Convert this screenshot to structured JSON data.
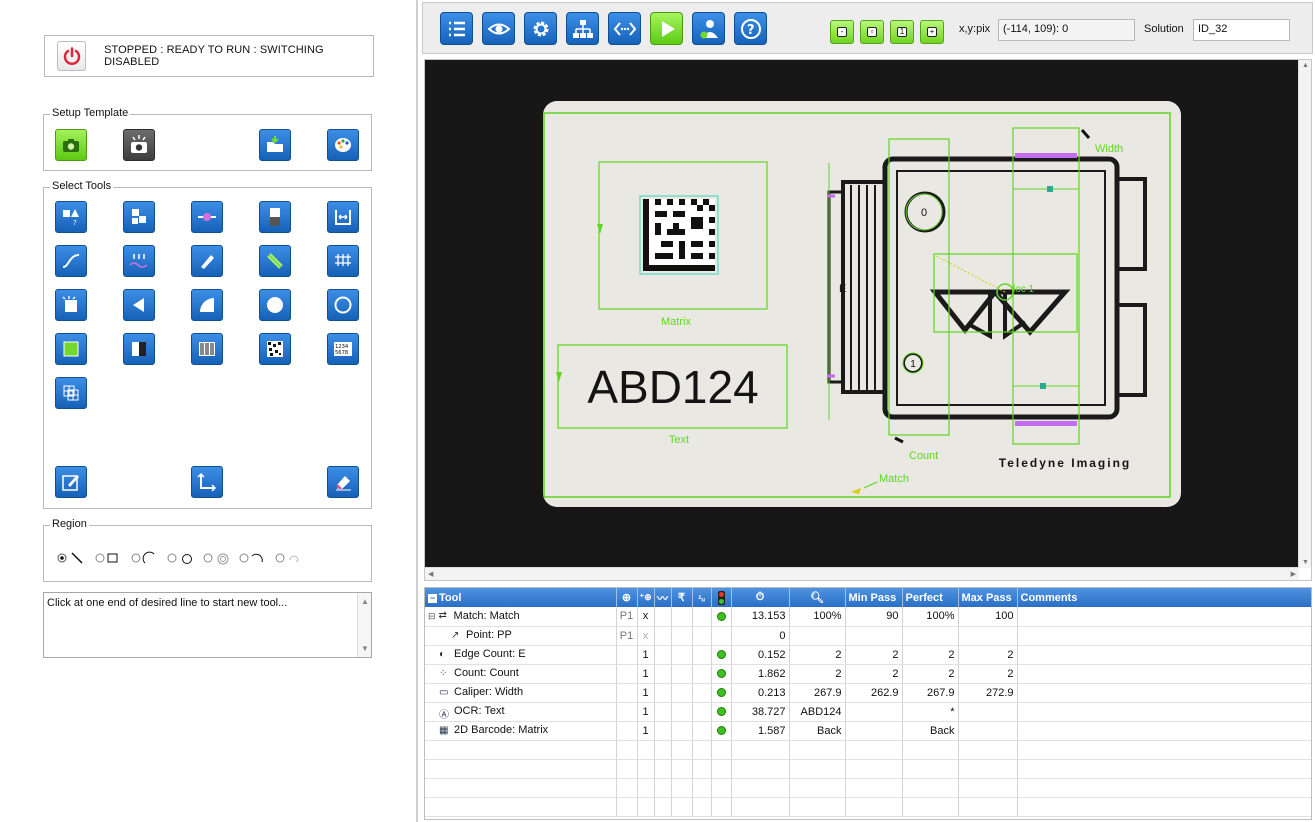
{
  "status": {
    "text": "STOPPED : READY TO RUN : SWITCHING DISABLED"
  },
  "setup_template": {
    "title": "Setup Template"
  },
  "select_tools": {
    "title": "Select Tools"
  },
  "region": {
    "title": "Region"
  },
  "hint": {
    "text": "Click at one end of desired line to start new tool..."
  },
  "toolbar": {
    "xy_label": "x,y:pix",
    "xy_value": "(-114, 109): 0",
    "solution_label": "Solution",
    "solution_value": "ID_32"
  },
  "image": {
    "ocr_text": "ABD124",
    "matrix_label": "Matrix",
    "text_label": "Text",
    "count_label": "Count",
    "match_label": "Match",
    "width_label": "Width",
    "e_label": "E",
    "loc_label": "loc 1",
    "circle0": "0",
    "circle1": "1",
    "brand": "Teledyne Imaging"
  },
  "table": {
    "headers": [
      "Tool",
      "",
      "",
      "",
      "",
      "",
      "",
      "",
      "",
      "Min Pass",
      "Perfect",
      "Max Pass",
      "Comments"
    ],
    "rows": [
      {
        "tool": "Match: Match",
        "ref": "P1",
        "x": "x",
        "time": "13.153",
        "result": "100%",
        "min": "90",
        "perfect": "100%",
        "max": "100",
        "status": true,
        "indent": 0
      },
      {
        "tool": "Point: PP",
        "ref": "P1",
        "x": "x",
        "time": "0",
        "result": "",
        "min": "",
        "perfect": "",
        "max": "",
        "status": false,
        "indent": 1
      },
      {
        "tool": "Edge Count: E",
        "ref": "",
        "x": "1",
        "time": "0.152",
        "result": "2",
        "min": "2",
        "perfect": "2",
        "max": "2",
        "status": true,
        "indent": 0
      },
      {
        "tool": "Count: Count",
        "ref": "",
        "x": "1",
        "time": "1.862",
        "result": "2",
        "min": "2",
        "perfect": "2",
        "max": "2",
        "status": true,
        "indent": 0
      },
      {
        "tool": "Caliper: Width",
        "ref": "",
        "x": "1",
        "time": "0.213",
        "result": "267.9",
        "min": "262.9",
        "perfect": "267.9",
        "max": "272.9",
        "status": true,
        "indent": 0
      },
      {
        "tool": "OCR: Text",
        "ref": "",
        "x": "1",
        "time": "38.727",
        "result": "ABD124",
        "min": "",
        "perfect": "*",
        "max": "",
        "status": true,
        "indent": 0
      },
      {
        "tool": "2D Barcode: Matrix",
        "ref": "",
        "x": "1",
        "time": "1.587",
        "result": "Back",
        "min": "",
        "perfect": "Back",
        "max": "",
        "status": true,
        "indent": 0
      }
    ]
  },
  "colors": {
    "accent_blue": "#2b6fc5",
    "accent_green": "#6fd123",
    "overlay_green": "#5fd622",
    "status_green": "#39c31c"
  }
}
